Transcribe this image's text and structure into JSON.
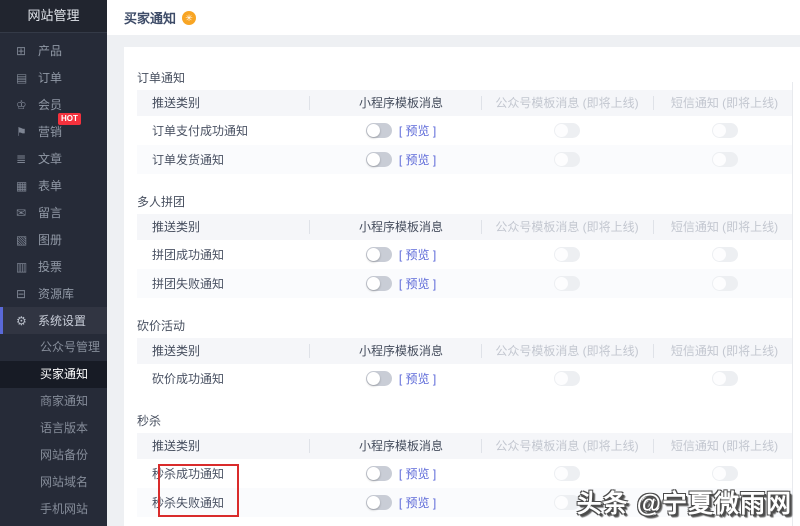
{
  "sidebar": {
    "title": "网站管理",
    "items": [
      {
        "label": "产品",
        "glyph": "⊞"
      },
      {
        "label": "订单",
        "glyph": "▤"
      },
      {
        "label": "会员",
        "glyph": "♔"
      },
      {
        "label": "营销",
        "glyph": "⚑",
        "badge": "HOT"
      },
      {
        "label": "文章",
        "glyph": "≣"
      },
      {
        "label": "表单",
        "glyph": "▦"
      },
      {
        "label": "留言",
        "glyph": "✉"
      },
      {
        "label": "图册",
        "glyph": "▧"
      },
      {
        "label": "投票",
        "glyph": "▥"
      },
      {
        "label": "资源库",
        "glyph": "⊟"
      },
      {
        "label": "系统设置",
        "glyph": "⚙",
        "state": "active"
      }
    ],
    "sub_items": [
      {
        "label": "公众号管理"
      },
      {
        "label": "买家通知",
        "state": "selected"
      },
      {
        "label": "商家通知"
      },
      {
        "label": "语言版本"
      },
      {
        "label": "网站备份"
      },
      {
        "label": "网站域名"
      },
      {
        "label": "手机网站"
      }
    ]
  },
  "header": {
    "title": "买家通知",
    "badge_glyph": "✳"
  },
  "table": {
    "columns": [
      "推送类别",
      "小程序模板消息",
      "公众号模板消息 (即将上线)",
      "短信通知 (即将上线)"
    ],
    "preview_label": "[ 预览 ]",
    "toggle_states": {
      "mini_program": "off",
      "official_account": "disabled-off",
      "sms": "disabled-off"
    }
  },
  "sections": [
    {
      "title": "订单通知",
      "rows": [
        {
          "label": "订单支付成功通知"
        },
        {
          "label": "订单发货通知"
        }
      ]
    },
    {
      "title": "多人拼团",
      "rows": [
        {
          "label": "拼团成功通知"
        },
        {
          "label": "拼团失败通知"
        }
      ]
    },
    {
      "title": "砍价活动",
      "rows": [
        {
          "label": "砍价成功通知"
        }
      ]
    },
    {
      "title": "秒杀",
      "rows": [
        {
          "label": "秒杀成功通知"
        },
        {
          "label": "秒杀失败通知"
        }
      ],
      "annotation": "red-box-around-row-labels"
    }
  ],
  "watermark": "头条 @宁夏微雨网",
  "colors": {
    "sidebar_bg": "#262b38",
    "sidebar_active_indicator": "#5a69d8",
    "sidebar_selected_bg": "#171b25",
    "hot_badge": "#f5313d",
    "title_badge": "#f8a524",
    "link": "#5c69d8",
    "annotation_red": "#d92b2b",
    "table_header_bg": "#f5f6f9",
    "content_bg": "#eef0f3"
  }
}
